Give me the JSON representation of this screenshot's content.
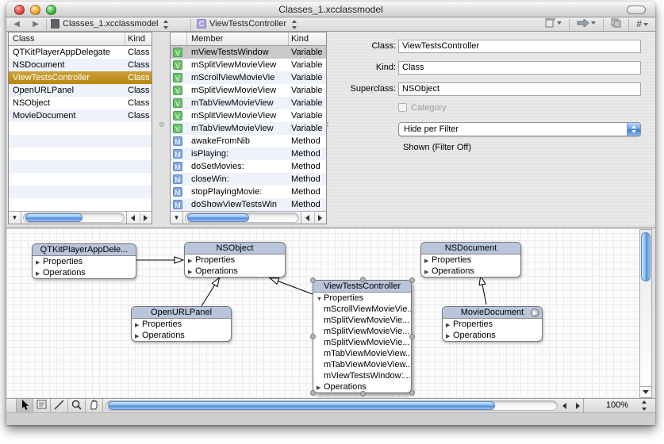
{
  "window": {
    "title": "Classes_1.xcclassmodel"
  },
  "navbar": {
    "back_label": "back",
    "forward_label": "forward",
    "file_popup": "Classes_1.xcclassmodel",
    "class_popup": "ViewTestsController",
    "right_icons": [
      "page-menu",
      "arrow-menu",
      "layers",
      "number-menu"
    ],
    "number_glyph": "#"
  },
  "class_list": {
    "columns": [
      "Class",
      "Kind"
    ],
    "selected_index": 2,
    "rows": [
      {
        "name": "QTKitPlayerAppDelegate",
        "kind": "Class"
      },
      {
        "name": "NSDocument",
        "kind": "Class"
      },
      {
        "name": "ViewTestsController",
        "kind": "Class"
      },
      {
        "name": "OpenURLPanel",
        "kind": "Class"
      },
      {
        "name": "NSObject",
        "kind": "Class"
      },
      {
        "name": "MovieDocument",
        "kind": "Class"
      }
    ]
  },
  "member_list": {
    "columns": [
      "Member",
      "Kind"
    ],
    "selected_index": 0,
    "rows": [
      {
        "icon": "V",
        "name": "mViewTestsWindow",
        "kind": "Variable"
      },
      {
        "icon": "V",
        "name": "mSplitViewMovieView",
        "kind": "Variable"
      },
      {
        "icon": "V",
        "name": "mScrollViewMovieVie",
        "kind": "Variable"
      },
      {
        "icon": "V",
        "name": "mSplitViewMovieView",
        "kind": "Variable"
      },
      {
        "icon": "V",
        "name": "mTabViewMovieView",
        "kind": "Variable"
      },
      {
        "icon": "V",
        "name": "mSplitViewMovieView",
        "kind": "Variable"
      },
      {
        "icon": "V",
        "name": "mTabViewMovieView",
        "kind": "Variable"
      },
      {
        "icon": "M",
        "name": "awakeFromNib",
        "kind": "Method"
      },
      {
        "icon": "M",
        "name": "isPlaying:",
        "kind": "Method"
      },
      {
        "icon": "M",
        "name": "doSetMovies:",
        "kind": "Method"
      },
      {
        "icon": "M",
        "name": "closeWin:",
        "kind": "Method"
      },
      {
        "icon": "M",
        "name": "stopPlayingMovie:",
        "kind": "Method"
      },
      {
        "icon": "M",
        "name": "doShowViewTestsWin",
        "kind": "Method"
      }
    ]
  },
  "inspector": {
    "class_label": "Class:",
    "class_value": "ViewTestsController",
    "kind_label": "Kind:",
    "kind_value": "Class",
    "superclass_label": "Superclass:",
    "superclass_value": "NSObject",
    "category_label": "Category",
    "filter_popup": "Hide per Filter",
    "filter_status": "Shown (Filter Off)"
  },
  "diagram": {
    "boxes": [
      {
        "id": "qtkit",
        "title": "QTKitPlayerAppDele...",
        "rows": [
          {
            "d": "closed",
            "text": "Properties"
          },
          {
            "d": "closed",
            "text": "Operations"
          }
        ]
      },
      {
        "id": "nsobject",
        "title": "NSObject",
        "rows": [
          {
            "d": "closed",
            "text": "Properties"
          },
          {
            "d": "closed",
            "text": "Operations"
          }
        ]
      },
      {
        "id": "nsdoc",
        "title": "NSDocument",
        "rows": [
          {
            "d": "closed",
            "text": "Properties"
          },
          {
            "d": "closed",
            "text": "Operations"
          }
        ]
      },
      {
        "id": "openurl",
        "title": "OpenURLPanel",
        "rows": [
          {
            "d": "closed",
            "text": "Properties"
          },
          {
            "d": "closed",
            "text": "Operations"
          }
        ]
      },
      {
        "id": "vtc",
        "title": "ViewTestsController",
        "rows": [
          {
            "d": "open",
            "text": "Properties"
          },
          {
            "text": "mScrollViewMovieVie..."
          },
          {
            "text": "mSplitViewMovieVie..."
          },
          {
            "text": "mSplitViewMovieVie..."
          },
          {
            "text": "mSplitViewMovieVie..."
          },
          {
            "text": "mTabViewMovieView..."
          },
          {
            "text": "mTabViewMovieView..."
          },
          {
            "text": "mViewTestsWindow:..."
          },
          {
            "d": "closed",
            "text": "Operations"
          }
        ]
      },
      {
        "id": "moviedoc",
        "title": "MovieDocument",
        "badge": true,
        "rows": [
          {
            "d": "closed",
            "text": "Properties"
          },
          {
            "d": "closed",
            "text": "Operations"
          }
        ]
      }
    ]
  },
  "bottom_bar": {
    "tools": [
      "pointer",
      "note",
      "line",
      "magnify",
      "hand"
    ],
    "zoom_value": "100%"
  },
  "colors": {
    "selection_gold": "#c0912a",
    "row_blue": "#edf2fb",
    "aqua_blue": "#4d8bd8",
    "box_header": "#b9c5da"
  }
}
